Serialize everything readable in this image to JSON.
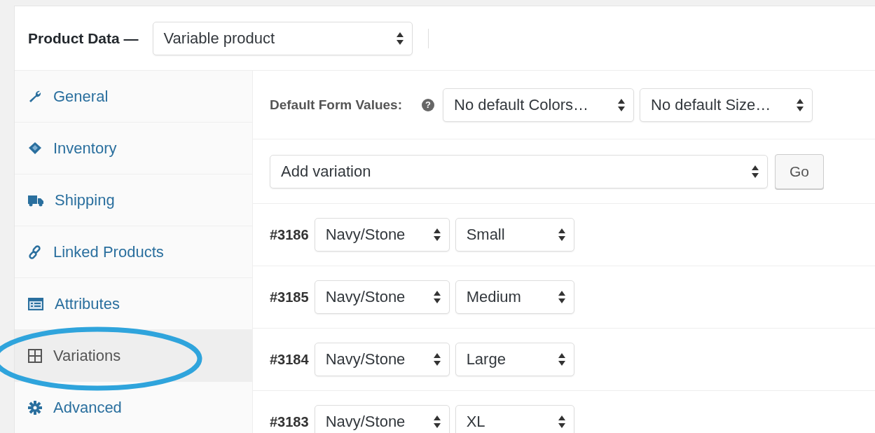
{
  "header": {
    "title": "Product Data —",
    "product_type": "Variable product"
  },
  "sidebar": {
    "items": [
      {
        "label": "General",
        "selected": false
      },
      {
        "label": "Inventory",
        "selected": false
      },
      {
        "label": "Shipping",
        "selected": false
      },
      {
        "label": "Linked Products",
        "selected": false
      },
      {
        "label": "Attributes",
        "selected": false
      },
      {
        "label": "Variations",
        "selected": true
      },
      {
        "label": "Advanced",
        "selected": false
      }
    ]
  },
  "defaults": {
    "label": "Default Form Values:",
    "help": "?",
    "selects": [
      "No default Colors…",
      "No default Size…"
    ]
  },
  "add_variation": {
    "select": "Add variation",
    "button": "Go"
  },
  "variations": [
    {
      "id": "#3186",
      "colors_option": "Navy/Stone",
      "size": "Small"
    },
    {
      "id": "#3185",
      "colors_option": "Navy/Stone",
      "size": "Medium"
    },
    {
      "id": "#3184",
      "colors_option": "Navy/Stone",
      "size": "Large"
    },
    {
      "id": "#3183",
      "colors_option": "Navy/Stone",
      "size": "XL"
    }
  ]
}
